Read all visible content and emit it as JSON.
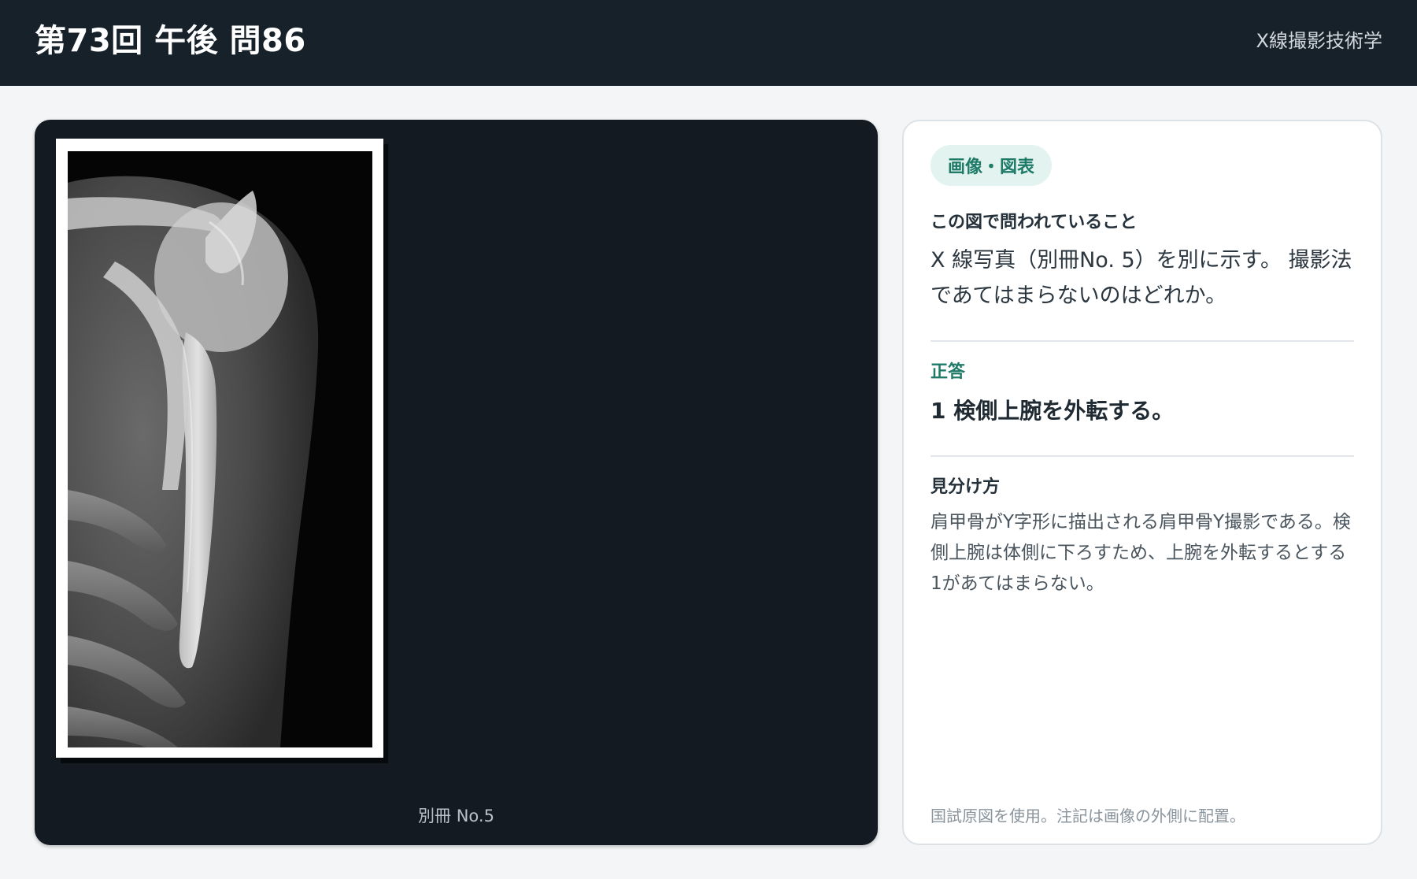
{
  "header": {
    "title": "第73回 午後 問86",
    "subject": "X線撮影技術学"
  },
  "figure": {
    "caption": "別冊 No.5"
  },
  "card": {
    "tag": "画像・図表",
    "question_label": "この図で問われていること",
    "question_text": "X 線写真（別冊No. 5）を別に示す。 撮影法であてはまらないのはどれか。",
    "answer_label": "正答",
    "answer_text": "1 検側上腕を外転する。",
    "explain_label": "見分け方",
    "explain_text": "肩甲骨がY字形に描出される肩甲骨Y撮影である。検側上腕は体側に下ろすため、上腕を外転するとする1があてはまらない。",
    "footnote": "国試原図を使用。注記は画像の外側に配置。"
  },
  "colors": {
    "header_bg": "#17212a",
    "panel_bg": "#131a21",
    "accent": "#1f7a68",
    "tag_bg": "#e3f4f0"
  }
}
